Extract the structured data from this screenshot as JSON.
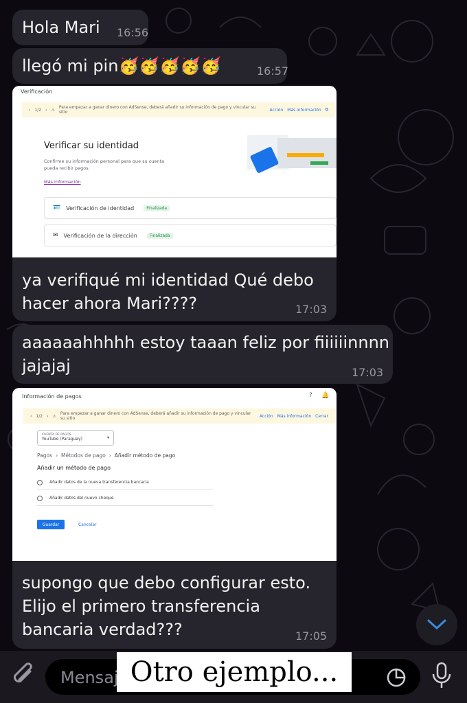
{
  "messages": [
    {
      "text": "Hola Mari",
      "time": "16:56"
    },
    {
      "text": "llegó mi pin🥳🥳🥳🥳🥳",
      "time": "16:57"
    },
    {
      "text_line1": "ya verifiqué mi identidad Qué debo",
      "text_line2": "hacer ahora Mari????",
      "time": "17:03"
    },
    {
      "text_line1": "aaaaaahhhhh estoy taaan feliz por fiiiiiinnnn",
      "text_line2": "jajajaj",
      "time": "17:03"
    },
    {
      "text_line1": "supongo que debo configurar esto.",
      "text_line2": "Elijo el primero transferencia",
      "text_line3": "bancaria verdad???",
      "time": "17:05"
    }
  ],
  "screenshot1": {
    "window_title": "Verificación",
    "pager": "1/2",
    "banner_text": "Para empezar a ganar dinero con AdSense, deberá añadir su información de pago y vincular su sitio",
    "banner_action": "Acción",
    "banner_more": "Más información",
    "heading": "Verificar su identidad",
    "description_line1": "Confirme su información personal para que su cuenta",
    "description_line2": "pueda recibir pagos.",
    "more_info_link": "Más información",
    "items": [
      {
        "label": "Verificación de identidad",
        "status": "Finalizada"
      },
      {
        "label": "Verificación de la dirección",
        "status": "Finalizada"
      }
    ]
  },
  "screenshot2": {
    "window_title": "Información de pagos",
    "pager": "1/2",
    "banner_text": "Para empezar a ganar dinero con AdSense, deberá añadir su información de pago y vincular su sitio",
    "banner_action": "Acción",
    "banner_more": "Más información",
    "banner_close": "Cerrar",
    "account_label": "CUENTA DE PAGOS",
    "account_value": "YouTube (Paraguay)",
    "breadcrumb": [
      "Pagos",
      "Métodos de pago",
      "Añadir método de pago"
    ],
    "section_title": "Añadir un método de pago",
    "options": [
      "Añadir datos de la nueva transferencia bancaria",
      "Añadir datos del nuevo cheque"
    ],
    "save_label": "Guardar",
    "cancel_label": "Cancelar"
  },
  "composer": {
    "placeholder": "Mensaj",
    "overlay_caption": "Otro ejemplo..."
  },
  "colors": {
    "bubble": "#26242c",
    "background": "#0c0a10",
    "accent_blue": "#1a73e8",
    "scroll_button_icon": "#3a8bdc"
  }
}
